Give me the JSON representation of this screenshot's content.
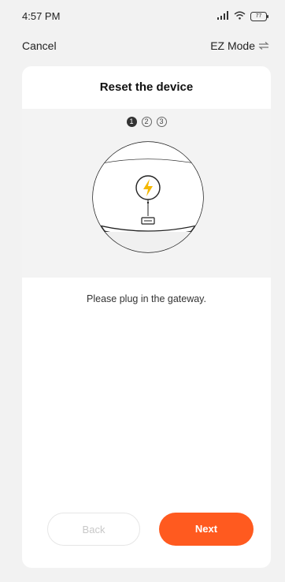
{
  "status_bar": {
    "time": "4:57 PM",
    "battery": "77"
  },
  "nav": {
    "cancel_label": "Cancel",
    "mode_label": "EZ Mode",
    "mode_icon": "swap-icon"
  },
  "card": {
    "title": "Reset the device",
    "steps": [
      "1",
      "2",
      "3"
    ],
    "active_step": 1,
    "instruction": "Please plug in the gateway."
  },
  "buttons": {
    "back_label": "Back",
    "next_label": "Next"
  },
  "colors": {
    "accent": "#ff5a1f",
    "bolt": "#f5b800"
  }
}
